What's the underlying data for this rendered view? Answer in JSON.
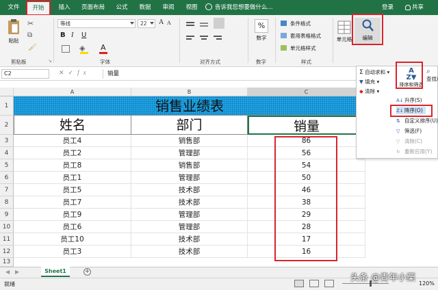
{
  "tabs": [
    "文件",
    "开始",
    "插入",
    "页面布局",
    "公式",
    "数据",
    "审阅",
    "视图"
  ],
  "tell_me": "告诉我您想要做什么...",
  "login": "登录",
  "share": "共享",
  "ribbon": {
    "clipboard": {
      "paste": "粘贴",
      "label": "剪贴板"
    },
    "font": {
      "name": "等线",
      "size": "22",
      "label": "字体",
      "bold": "B",
      "italic": "I",
      "underline": "U",
      "grow": "A",
      "shrink": "A"
    },
    "alignment": {
      "label": "对齐方式"
    },
    "number": {
      "label": "数字",
      "percent": "%"
    },
    "styles": {
      "conditional": "条件格式",
      "table": "套用表格格式",
      "cell": "单元格样式",
      "label": "样式"
    },
    "cells": {
      "label": "单元格"
    },
    "editing": {
      "label": "编辑"
    }
  },
  "editing_menu": {
    "autosum": "自动求和",
    "fill": "填充",
    "clear": "清除",
    "sort_filter": "排序和筛选",
    "find_select": "查找和",
    "items": [
      {
        "label": "升序(S)",
        "enabled": true
      },
      {
        "label": "降序(O)",
        "enabled": true
      },
      {
        "label": "自定义排序(U)...",
        "enabled": true
      },
      {
        "label": "筛选(F)",
        "enabled": true
      },
      {
        "label": "清除(C)",
        "enabled": false
      },
      {
        "label": "重新应用(Y)",
        "enabled": false
      }
    ]
  },
  "formula_bar": {
    "name_box": "C2",
    "content": "销量"
  },
  "columns": [
    "A",
    "B",
    "C"
  ],
  "sheet": {
    "title": "销售业绩表",
    "headers": [
      "姓名",
      "部门",
      "销量"
    ],
    "rows": [
      [
        "员工4",
        "销售部",
        "86"
      ],
      [
        "员工2",
        "管理部",
        "56"
      ],
      [
        "员工8",
        "销售部",
        "54"
      ],
      [
        "员工1",
        "管理部",
        "50"
      ],
      [
        "员工5",
        "技术部",
        "46"
      ],
      [
        "员工7",
        "技术部",
        "38"
      ],
      [
        "员工9",
        "管理部",
        "29"
      ],
      [
        "员工6",
        "管理部",
        "28"
      ],
      [
        "员工10",
        "技术部",
        "17"
      ],
      [
        "员工3",
        "技术部",
        "16"
      ]
    ]
  },
  "row_numbers": [
    "1",
    "2",
    "3",
    "4",
    "5",
    "6",
    "7",
    "8",
    "9",
    "10",
    "11",
    "12",
    "13"
  ],
  "sheet_tab": "Sheet1",
  "status": "就绪",
  "zoom": "120%",
  "watermark": "头条 @青年小栗",
  "colors": {
    "accent": "#217346",
    "title_fill": "#1fa4e6",
    "highlight": "#d9232a"
  }
}
